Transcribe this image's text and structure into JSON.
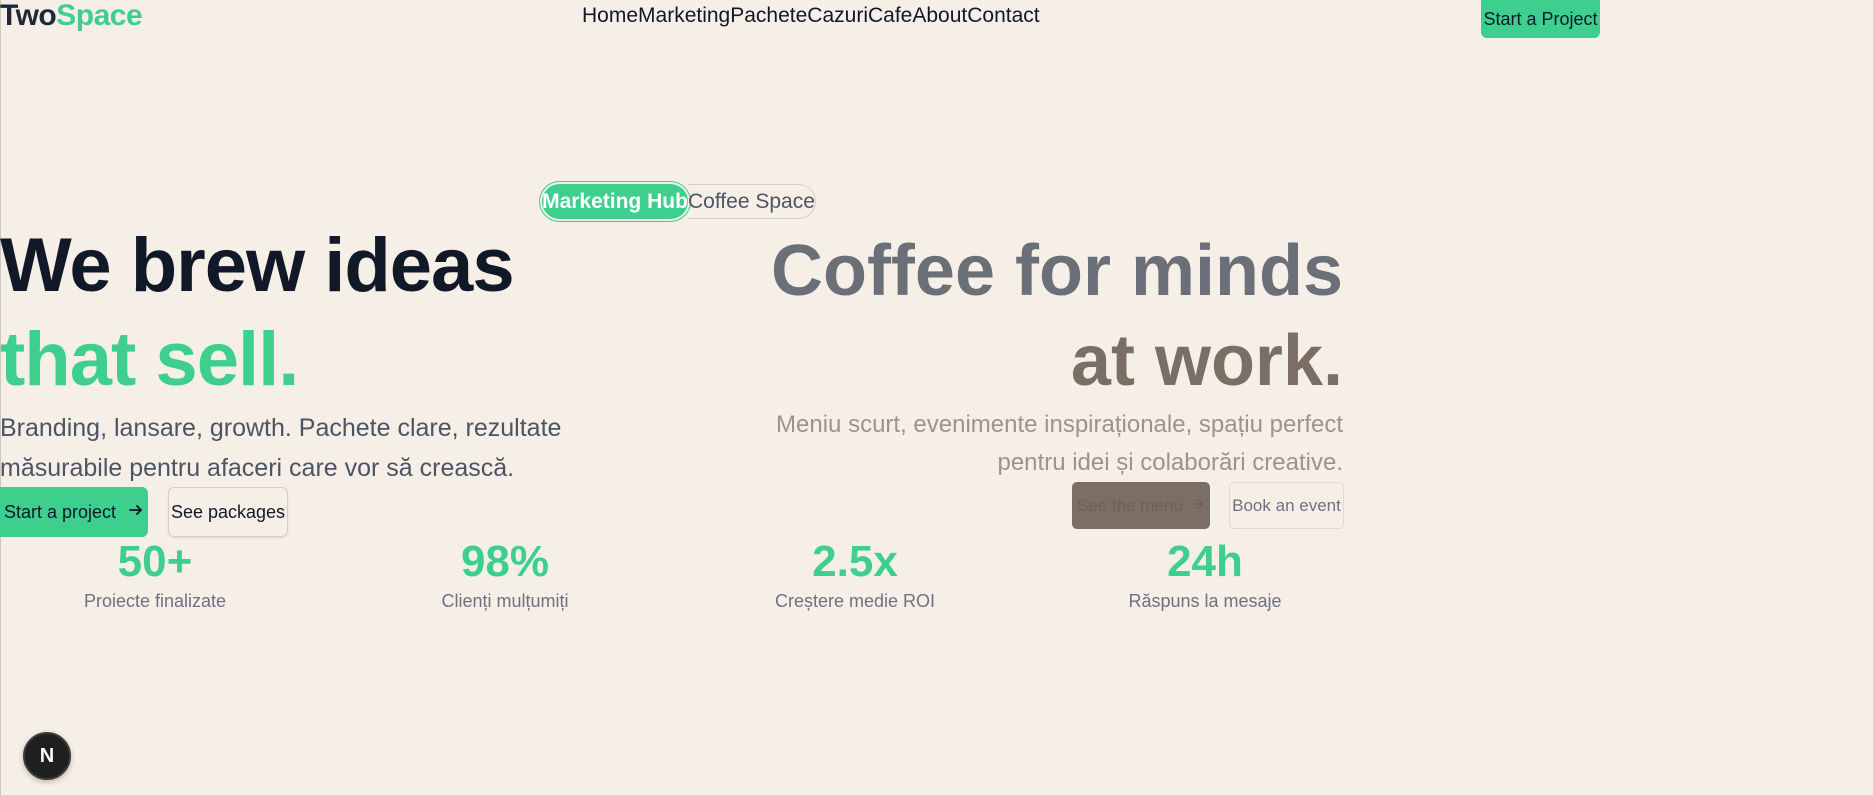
{
  "header": {
    "logo_part1": "Two",
    "logo_part2": "Space",
    "nav": [
      "Home",
      "Marketing",
      "Pachete",
      "Cazuri",
      "Cafe",
      "About",
      "Contact"
    ],
    "cta": "Start a Project"
  },
  "toggle": {
    "active": "Marketing Hub",
    "inactive": "Coffee Space"
  },
  "marketing": {
    "headline1": "We brew ideas",
    "headline2": "that sell.",
    "lead": "Branding, lansare, growth. Pachete clare, rezultate măsurabile pentru afaceri care vor să crească.",
    "primary_button": "Start a project",
    "secondary_button": "See packages"
  },
  "coffee": {
    "headline1": "Coffee for minds",
    "headline2": "at work.",
    "lead": "Meniu scurt, evenimente inspiraționale, spațiu perfect pentru idei și colaborări creative.",
    "primary_button": "See the menu",
    "secondary_button": "Book an event"
  },
  "stats": [
    {
      "value": "50+",
      "label": "Proiecte finalizate"
    },
    {
      "value": "98%",
      "label": "Clienți mulțumiți"
    },
    {
      "value": "2.5x",
      "label": "Creștere medie ROI"
    },
    {
      "value": "24h",
      "label": "Răspuns la mesaje"
    }
  ],
  "dev_badge": "N",
  "colors": {
    "background": "#f6efe7",
    "accent": "#3ecf8e",
    "dark_text": "#111827",
    "coffee_brown": "#7a6e65"
  }
}
